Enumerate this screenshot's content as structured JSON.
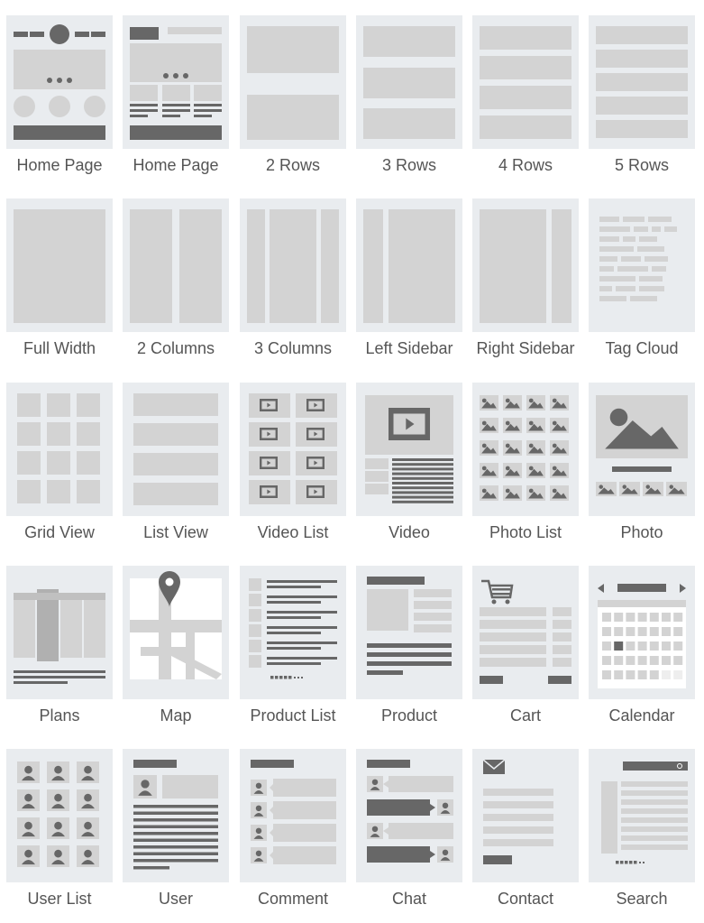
{
  "colors": {
    "card": "#e9ecef",
    "block": "#d3d3d3",
    "dark": "#676767",
    "white": "#ffffff",
    "label": "#555555"
  },
  "templates": [
    {
      "label": "Home Page"
    },
    {
      "label": "Home Page"
    },
    {
      "label": "2 Rows"
    },
    {
      "label": "3 Rows"
    },
    {
      "label": "4 Rows"
    },
    {
      "label": "5 Rows"
    },
    {
      "label": "Full Width"
    },
    {
      "label": "2 Columns"
    },
    {
      "label": "3 Columns"
    },
    {
      "label": "Left Sidebar"
    },
    {
      "label": "Right Sidebar"
    },
    {
      "label": "Tag Cloud"
    },
    {
      "label": "Grid View"
    },
    {
      "label": "List View"
    },
    {
      "label": "Video List"
    },
    {
      "label": "Video"
    },
    {
      "label": "Photo List"
    },
    {
      "label": "Photo"
    },
    {
      "label": "Plans"
    },
    {
      "label": "Map"
    },
    {
      "label": "Product List"
    },
    {
      "label": "Product"
    },
    {
      "label": "Cart"
    },
    {
      "label": "Calendar"
    },
    {
      "label": "User List"
    },
    {
      "label": "User"
    },
    {
      "label": "Comment"
    },
    {
      "label": "Chat"
    },
    {
      "label": "Contact"
    },
    {
      "label": "Search"
    }
  ]
}
